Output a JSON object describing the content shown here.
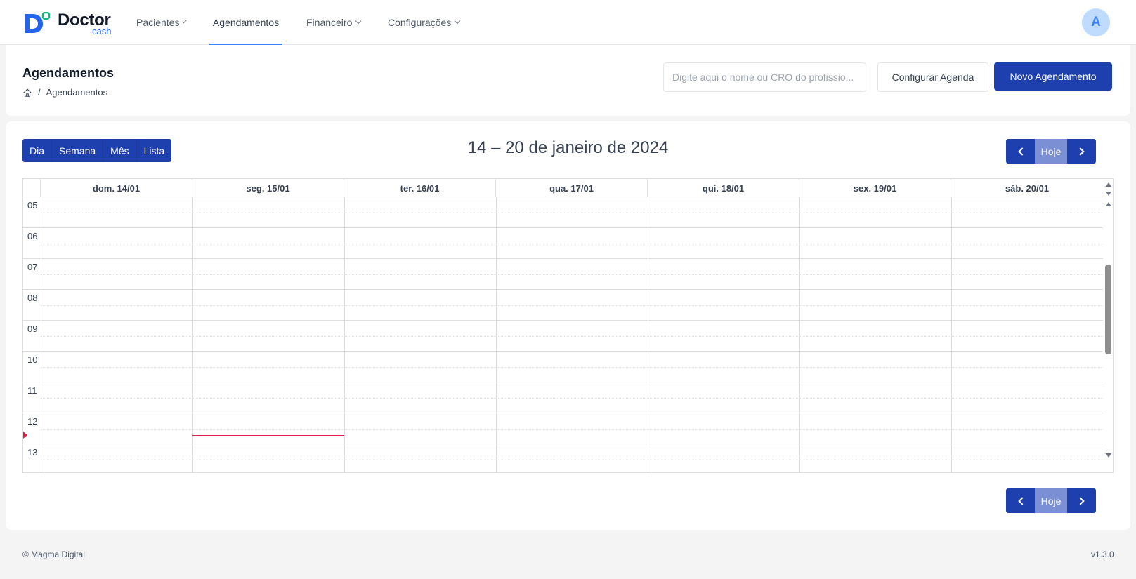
{
  "brand": {
    "name": "Doctor",
    "sub": "cash"
  },
  "nav": {
    "items": [
      {
        "label": "Pacientes",
        "dropdown": true
      },
      {
        "label": "Agendamentos",
        "dropdown": false,
        "active": true
      },
      {
        "label": "Financeiro",
        "dropdown": true
      },
      {
        "label": "Configurações",
        "dropdown": true
      }
    ]
  },
  "user": {
    "avatar_initial": "A"
  },
  "header": {
    "title": "Agendamentos",
    "breadcrumb": {
      "current": "Agendamentos"
    },
    "search_placeholder": "Digite aqui o nome ou CRO do profissio...",
    "configure_label": "Configurar Agenda",
    "new_label": "Novo Agendamento"
  },
  "calendar": {
    "views": [
      "Dia",
      "Semana",
      "Mês",
      "Lista"
    ],
    "title": "14 – 20 de janeiro de 2024",
    "today_label": "Hoje",
    "days": [
      "dom. 14/01",
      "seg. 15/01",
      "ter. 16/01",
      "qua. 17/01",
      "qui. 18/01",
      "sex. 19/01",
      "sáb. 20/01"
    ],
    "hours": [
      "05",
      "06",
      "07",
      "08",
      "09",
      "10",
      "11",
      "12",
      "13"
    ]
  },
  "colors": {
    "primary": "#1e40af",
    "today_btn": "#7b8fd4",
    "now_indicator": "#e11d48",
    "accent": "#3b82f6"
  },
  "footer": {
    "copyright": "© Magma Digital",
    "version": "v1.3.0"
  }
}
